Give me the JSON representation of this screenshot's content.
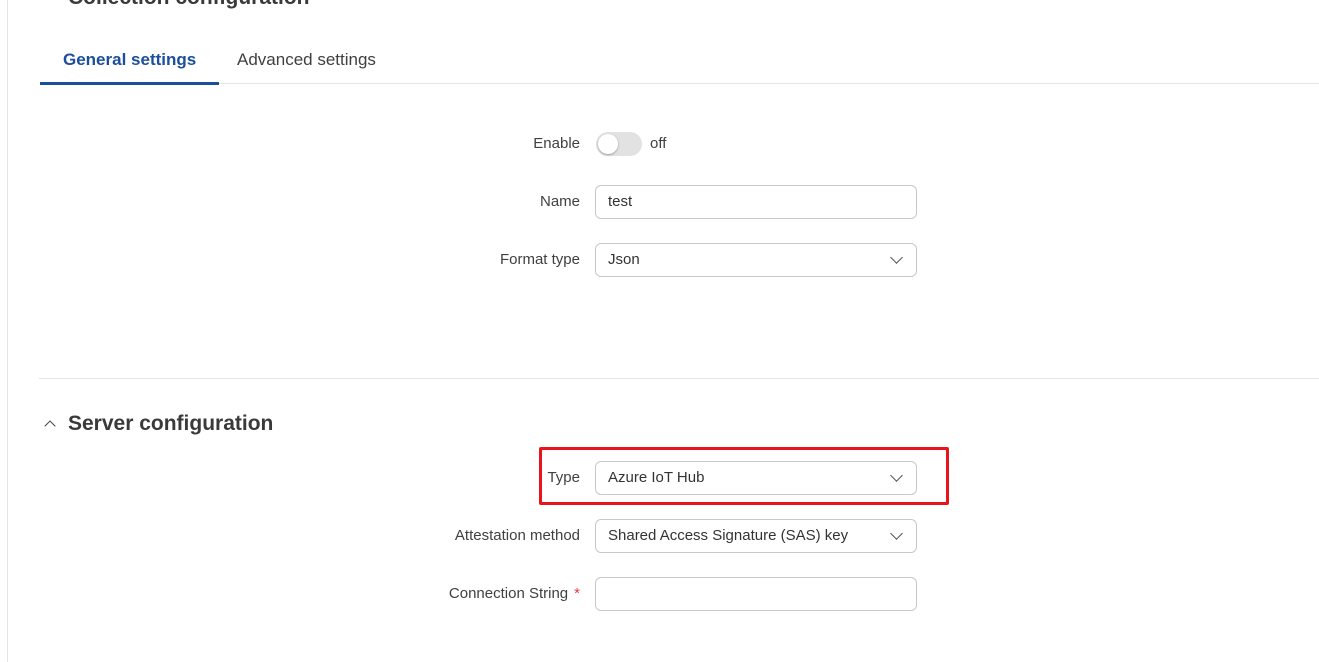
{
  "section_top": {
    "title": "Collection configuration"
  },
  "tabs": [
    {
      "label": "General settings",
      "active": true
    },
    {
      "label": "Advanced settings",
      "active": false
    }
  ],
  "general": {
    "enable": {
      "label": "Enable",
      "state": "off"
    },
    "name": {
      "label": "Name",
      "value": "test"
    },
    "format_type": {
      "label": "Format type",
      "value": "Json"
    }
  },
  "server": {
    "title": "Server configuration",
    "type": {
      "label": "Type",
      "value": "Azure IoT Hub"
    },
    "attestation_method": {
      "label": "Attestation method",
      "value": "Shared Access Signature (SAS) key"
    },
    "connection_string": {
      "label": "Connection String",
      "required_mark": "*",
      "value": ""
    }
  },
  "colors": {
    "accent": "#1b4f9c",
    "highlight": "#e8141c",
    "required": "#e03b3b"
  },
  "icons": {
    "select": "chevron-down-icon",
    "collapse": "chevron-up-icon"
  }
}
